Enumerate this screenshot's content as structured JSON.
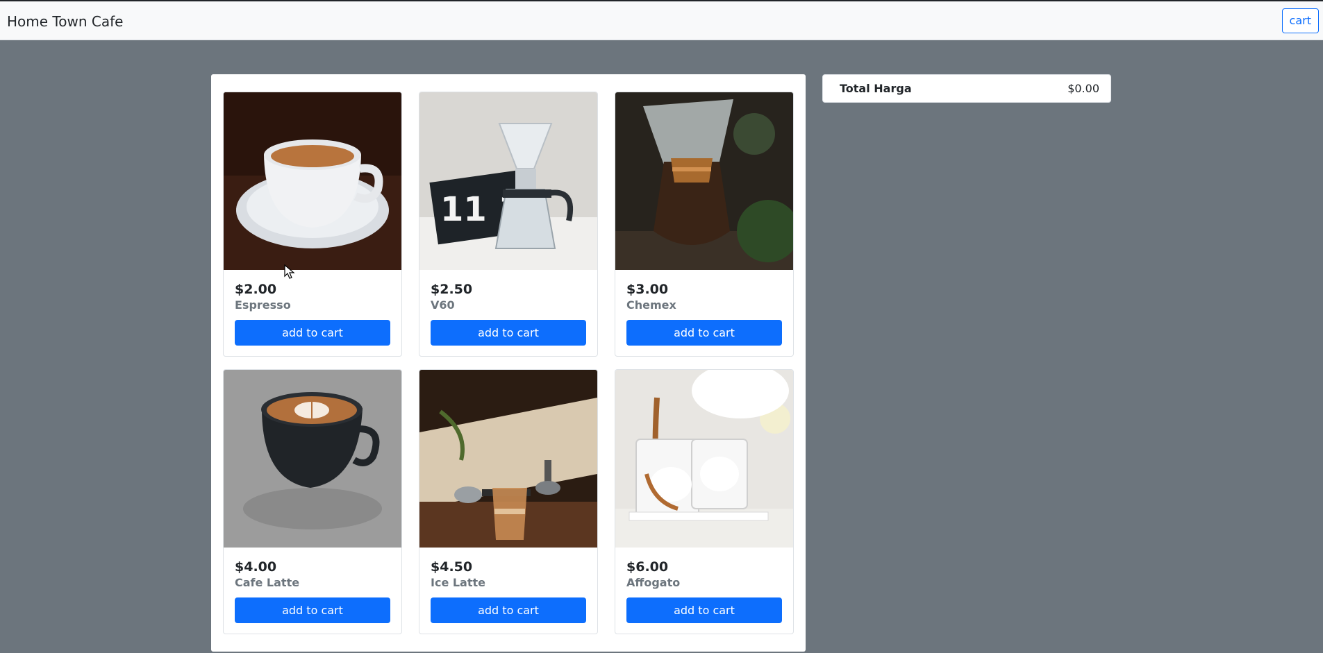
{
  "navbar": {
    "brand": "Home Town Cafe",
    "cart_label": "cart"
  },
  "products": [
    {
      "price": "$2.00",
      "name": "Espresso",
      "button": "add to cart",
      "image": "espresso-photo"
    },
    {
      "price": "$2.50",
      "name": "V60",
      "button": "add to cart",
      "image": "v60-photo"
    },
    {
      "price": "$3.00",
      "name": "Chemex",
      "button": "add to cart",
      "image": "chemex-photo"
    },
    {
      "price": "$4.00",
      "name": "Cafe Latte",
      "button": "add to cart",
      "image": "cafe-latte-photo"
    },
    {
      "price": "$4.50",
      "name": "Ice Latte",
      "button": "add to cart",
      "image": "ice-latte-photo"
    },
    {
      "price": "$6.00",
      "name": "Affogato",
      "button": "add to cart",
      "image": "affogato-photo"
    }
  ],
  "cart_summary": {
    "label": "Total Harga",
    "total": "$0.00"
  },
  "colors": {
    "accent": "#0d6efd",
    "background": "#6c757d",
    "navbar": "#f8f9fa"
  }
}
